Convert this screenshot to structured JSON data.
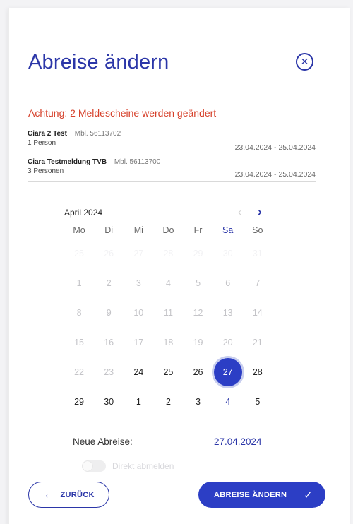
{
  "dialog": {
    "title": "Abreise ändern",
    "close_icon": "close-circle-icon",
    "close_glyph": "✕",
    "warning": "Achtung: 2 Meldescheine werden geändert"
  },
  "bookings": [
    {
      "name": "Ciara 2 Test",
      "mbl": "Mbl. 56113702",
      "persons": "1 Person",
      "dates": "23.04.2024 - 25.04.2024"
    },
    {
      "name": "Ciara Testmeldung TVB",
      "mbl": "Mbl. 56113700",
      "persons": "3 Personen",
      "dates": "23.04.2024 - 25.04.2024"
    }
  ],
  "calendar": {
    "month_label": "April 2024",
    "prev_icon": "chevron-left-icon",
    "prev_glyph": "‹",
    "next_icon": "chevron-right-icon",
    "next_glyph": "›",
    "weekdays": [
      "Mo",
      "Di",
      "Mi",
      "Do",
      "Fr",
      "Sa",
      "So"
    ],
    "weeks": [
      [
        "25",
        "26",
        "27",
        "28",
        "29",
        "30",
        "31"
      ],
      [
        "1",
        "2",
        "3",
        "4",
        "5",
        "6",
        "7"
      ],
      [
        "8",
        "9",
        "10",
        "11",
        "12",
        "13",
        "14"
      ],
      [
        "15",
        "16",
        "17",
        "18",
        "19",
        "20",
        "21"
      ],
      [
        "22",
        "23",
        "24",
        "25",
        "26",
        "27",
        "28"
      ],
      [
        "29",
        "30",
        "1",
        "2",
        "3",
        "4",
        "5"
      ]
    ],
    "selected": "27"
  },
  "new_departure": {
    "label": "Neue Abreise:",
    "value": "27.04.2024"
  },
  "toggle": {
    "label": "Direkt abmelden",
    "checked": false
  },
  "buttons": {
    "back_label": "ZURÜCK",
    "back_icon": "arrow-left-icon",
    "back_glyph": "←",
    "submit_label": "ABREISE ÄNDERN",
    "submit_icon": "check-icon",
    "submit_glyph": "✓"
  },
  "colors": {
    "accent": "#2b36a8",
    "primary_button": "#2c3ec5",
    "warning": "#d6402a"
  }
}
